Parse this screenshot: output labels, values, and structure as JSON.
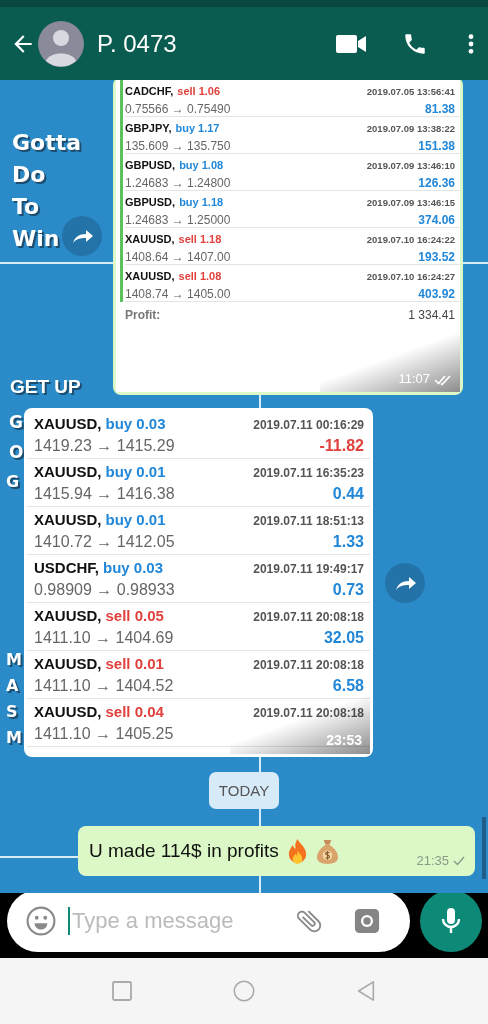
{
  "header": {
    "title": "P. 0473"
  },
  "wallpaper": {
    "texts": [
      {
        "text": "Gotta",
        "kind": "big"
      },
      {
        "text": "Do",
        "kind": "big"
      },
      {
        "text": "To",
        "kind": "big"
      },
      {
        "text": "Win",
        "kind": "big"
      },
      {
        "text": "GET UP",
        "kind": "banner"
      },
      {
        "text": "G",
        "kind": "cut"
      },
      {
        "text": "O",
        "kind": "cut"
      },
      {
        "text": "G",
        "kind": "cut"
      },
      {
        "text": "M",
        "kind": "cut2"
      },
      {
        "text": "A",
        "kind": "cut2"
      },
      {
        "text": "S",
        "kind": "cut2"
      },
      {
        "text": "M",
        "kind": "cut2"
      }
    ]
  },
  "messages": [
    {
      "kind": "report",
      "outgoing": true,
      "time": "11:07",
      "read": true,
      "trades": [
        {
          "symbol": "CADCHF,",
          "order": "sell 1.06",
          "sell": true,
          "prices": "0.75566 → 0.75490",
          "time": "2019.07.05 13:56:41",
          "profit": "81.38",
          "loss": false
        },
        {
          "symbol": "GBPJPY,",
          "order": "buy 1.17",
          "sell": false,
          "prices": "135.609 → 135.750",
          "time": "2019.07.09 13:38:22",
          "profit": "151.38",
          "loss": false
        },
        {
          "symbol": "GBPUSD,",
          "order": "buy 1.08",
          "sell": false,
          "prices": "1.24683 → 1.24800",
          "time": "2019.07.09 13:46:10",
          "profit": "126.36",
          "loss": false
        },
        {
          "symbol": "GBPUSD,",
          "order": "buy 1.18",
          "sell": false,
          "prices": "1.24683 → 1.25000",
          "time": "2019.07.09 13:46:15",
          "profit": "374.06",
          "loss": false
        },
        {
          "symbol": "XAUUSD,",
          "order": "sell 1.18",
          "sell": true,
          "prices": "1408.64 → 1407.00",
          "time": "2019.07.10 16:24:22",
          "profit": "193.52",
          "loss": false
        },
        {
          "symbol": "XAUUSD,",
          "order": "sell 1.08",
          "sell": true,
          "prices": "1408.74 → 1405.00",
          "time": "2019.07.10 16:24:27",
          "profit": "403.92",
          "loss": false
        }
      ],
      "profit_label": "Profit:",
      "profit_total": "1 334.41"
    },
    {
      "kind": "history",
      "outgoing": false,
      "time": "23:53",
      "trades": [
        {
          "symbol": "XAUUSD,",
          "order": "buy 0.03",
          "sell": false,
          "prices": "1419.23 → 1415.29",
          "time": "2019.07.11 00:16:29",
          "profit": "-11.82",
          "loss": true
        },
        {
          "symbol": "XAUUSD,",
          "order": "buy 0.01",
          "sell": false,
          "prices": "1415.94 → 1416.38",
          "time": "2019.07.11 16:35:23",
          "profit": "0.44",
          "loss": false
        },
        {
          "symbol": "XAUUSD,",
          "order": "buy 0.01",
          "sell": false,
          "prices": "1410.72 → 1412.05",
          "time": "2019.07.11 18:51:13",
          "profit": "1.33",
          "loss": false
        },
        {
          "symbol": "USDCHF,",
          "order": "buy 0.03",
          "sell": false,
          "prices": "0.98909 → 0.98933",
          "time": "2019.07.11 19:49:17",
          "profit": "0.73",
          "loss": false
        },
        {
          "symbol": "XAUUSD,",
          "order": "sell 0.05",
          "sell": true,
          "prices": "1411.10 → 1404.69",
          "time": "2019.07.11 20:08:18",
          "profit": "32.05",
          "loss": false
        },
        {
          "symbol": "XAUUSD,",
          "order": "sell 0.01",
          "sell": true,
          "prices": "1411.10 → 1404.52",
          "time": "2019.07.11 20:08:18",
          "profit": "6.58",
          "loss": false
        },
        {
          "symbol": "XAUUSD,",
          "order": "sell 0.04",
          "sell": true,
          "prices": "1411.10 → 1405.25",
          "time": "2019.07.11 20:08:18"
        }
      ]
    },
    {
      "kind": "date",
      "text": "TODAY"
    },
    {
      "kind": "text",
      "outgoing": true,
      "text": "U made 114$ in profits",
      "time": "21:35",
      "read": false
    }
  ],
  "composer": {
    "placeholder": "Type a message"
  }
}
